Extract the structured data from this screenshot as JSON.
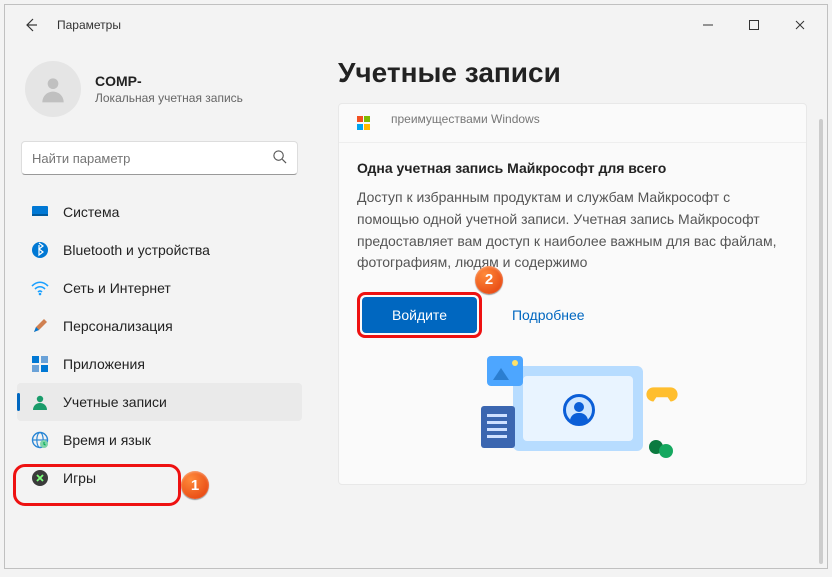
{
  "window": {
    "title": "Параметры"
  },
  "profile": {
    "name": "COMP-",
    "account_type": "Локальная учетная запись"
  },
  "search": {
    "placeholder": "Найти параметр"
  },
  "nav": [
    {
      "key": "system",
      "label": "Система"
    },
    {
      "key": "bluetooth",
      "label": "Bluetooth и устройства"
    },
    {
      "key": "network",
      "label": "Сеть и Интернет"
    },
    {
      "key": "personalization",
      "label": "Персонализация"
    },
    {
      "key": "apps",
      "label": "Приложения"
    },
    {
      "key": "accounts",
      "label": "Учетные записи"
    },
    {
      "key": "time",
      "label": "Время и язык"
    },
    {
      "key": "games",
      "label": "Игры"
    }
  ],
  "page": {
    "title": "Учетные записи",
    "top_hint": "преимуществами Windows",
    "card_title": "Одна учетная запись Майкрософт для всего",
    "card_desc": "Доступ к избранным продуктам и службам Майкрософт с помощью одной учетной записи. Учетная запись Майкрософт предоставляет вам доступ к наиболее важным для вас файлам, фотографиям, людям и содержимо",
    "signin_label": "Войдите",
    "more_label": "Подробнее"
  },
  "markers": {
    "one": "1",
    "two": "2"
  }
}
